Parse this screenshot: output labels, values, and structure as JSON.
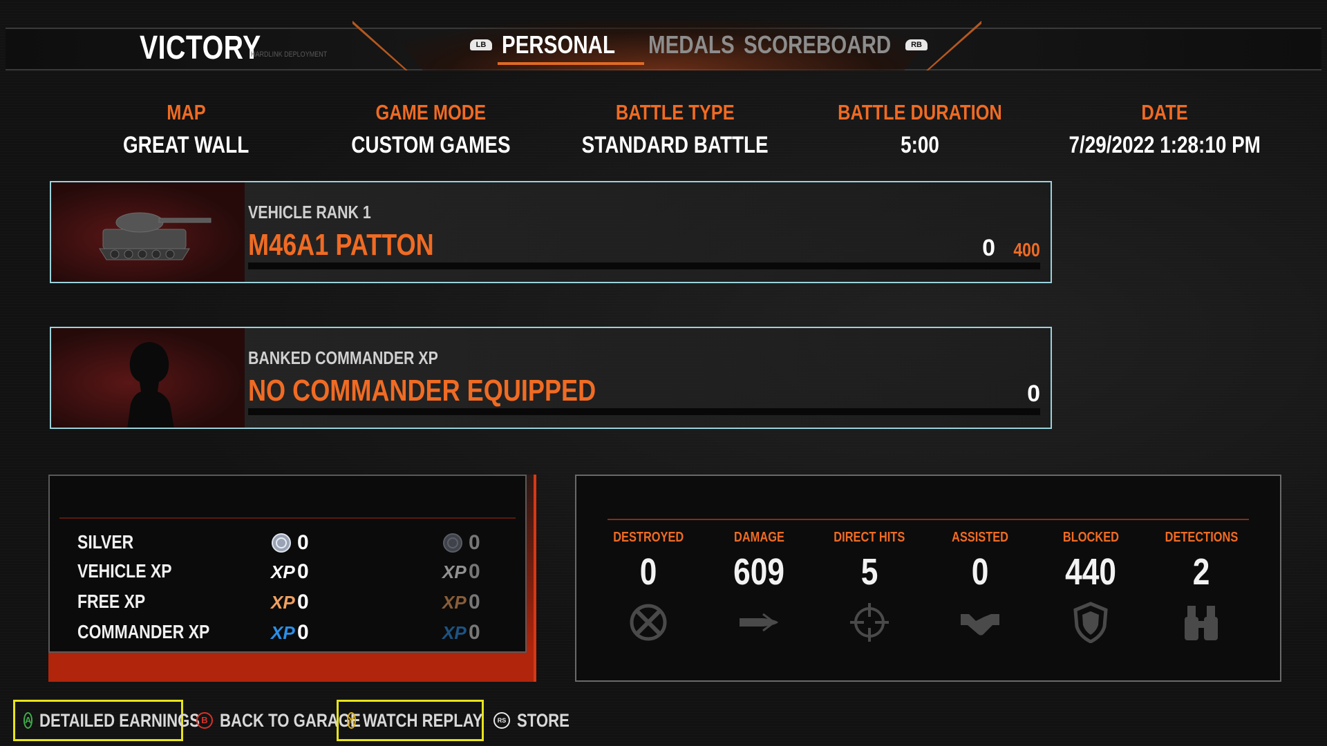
{
  "header": {
    "result": "VICTORY",
    "subtitle": "HARDLINK DEPLOYMENT",
    "lb": "LB",
    "rb": "RB",
    "tabs": [
      {
        "label": "PERSONAL",
        "active": true
      },
      {
        "label": "MEDALS",
        "active": false
      },
      {
        "label": "SCOREBOARD",
        "active": false
      }
    ]
  },
  "info": {
    "map_label": "MAP",
    "map_value": "GREAT WALL",
    "mode_label": "GAME MODE",
    "mode_value": "CUSTOM GAMES",
    "type_label": "BATTLE TYPE",
    "type_value": "STANDARD BATTLE",
    "duration_label": "BATTLE DURATION",
    "duration_value": "5:00",
    "date_label": "DATE",
    "date_value": "7/29/2022 1:28:10 PM"
  },
  "vehicle": {
    "rank": "VEHICLE RANK 1",
    "name": "M46A1 PATTON",
    "xp_current": "0",
    "xp_next": "400"
  },
  "commander": {
    "label": "BANKED COMMANDER XP",
    "status": "NO COMMANDER EQUIPPED",
    "xp": "0"
  },
  "earnings": [
    {
      "label": "SILVER",
      "icon": "silver-coin-icon",
      "value": "0",
      "value2": "0"
    },
    {
      "label": "VEHICLE XP",
      "icon": "vehicle-xp-icon",
      "xp_text": "XP",
      "xp_color": "#ffffff",
      "value": "0",
      "value2": "0"
    },
    {
      "label": "FREE XP",
      "icon": "free-xp-icon",
      "xp_text": "XP",
      "xp_color": "#f0a060",
      "value": "0",
      "value2": "0"
    },
    {
      "label": "COMMANDER XP",
      "icon": "commander-xp-icon",
      "xp_text": "XP",
      "xp_color": "#2a8fe8",
      "value": "0",
      "value2": "0"
    }
  ],
  "stats": [
    {
      "label": "DESTROYED",
      "value": "0",
      "icon": "destroyed-icon"
    },
    {
      "label": "DAMAGE",
      "value": "609",
      "icon": "shell-icon"
    },
    {
      "label": "DIRECT HITS",
      "value": "5",
      "icon": "crosshair-icon"
    },
    {
      "label": "ASSISTED",
      "value": "0",
      "icon": "handshake-icon"
    },
    {
      "label": "BLOCKED",
      "value": "440",
      "icon": "shield-icon"
    },
    {
      "label": "DETECTIONS",
      "value": "2",
      "icon": "binoculars-icon"
    }
  ],
  "actions": [
    {
      "button": "A",
      "label": "DETAILED EARNINGS",
      "color": "#3fae4a"
    },
    {
      "button": "B",
      "label": "BACK TO GARAGE",
      "color": "#d8322b"
    },
    {
      "button": "Y",
      "label": "WATCH REPLAY",
      "color": "#e0b51a"
    },
    {
      "button": "RS",
      "label": "STORE",
      "color": "#e8e8e8"
    }
  ],
  "colors": {
    "accent": "#f06b23",
    "highlight": "#e8e41a",
    "panel_border": "#9ad3dc"
  }
}
